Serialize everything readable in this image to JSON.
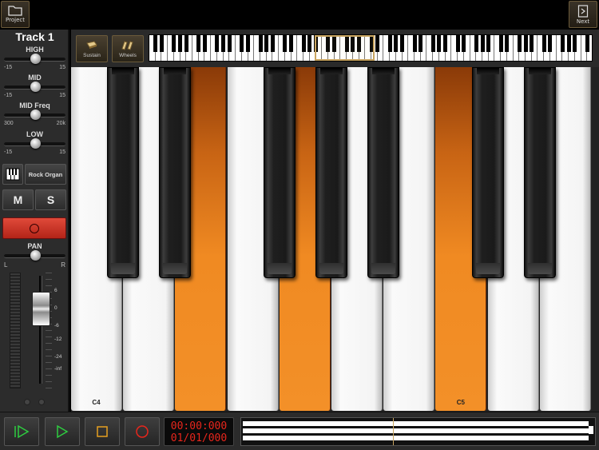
{
  "topbar": {
    "project_label": "Project",
    "next_label": "Next",
    "project_icon": "folder-icon",
    "next_icon": "page-arrow-icon"
  },
  "track": {
    "title": "Track 1",
    "eq": [
      {
        "label": "HIGH",
        "min": "-15",
        "max": "15",
        "value": 0.5
      },
      {
        "label": "MID",
        "min": "-15",
        "max": "15",
        "value": 0.5
      },
      {
        "label": "MID Freq",
        "min": "300",
        "max": "20k",
        "value": 0.5
      },
      {
        "label": "LOW",
        "min": "-15",
        "max": "15",
        "value": 0.5
      }
    ],
    "instrument": {
      "icon": "keyboard-icon",
      "name": "Rock Organ"
    },
    "mute_label": "M",
    "solo_label": "S",
    "record_arm_color": "#d63a2a",
    "pan": {
      "label": "PAN",
      "left": "L",
      "right": "R",
      "value": 0.5
    },
    "fader": {
      "scale": [
        "6",
        "0",
        "-6",
        "-12",
        "-24",
        "-inf"
      ],
      "value_db": "0"
    }
  },
  "keyboard_header": {
    "sustain_label": "Sustain",
    "wheels_label": "Wheels",
    "accent_color": "#c9a560"
  },
  "keyboard": {
    "white_keys": [
      {
        "note": "C4",
        "pressed": false
      },
      {
        "note": "",
        "pressed": false
      },
      {
        "note": "",
        "pressed": true
      },
      {
        "note": "",
        "pressed": false
      },
      {
        "note": "",
        "pressed": true
      },
      {
        "note": "",
        "pressed": false
      },
      {
        "note": "",
        "pressed": false
      },
      {
        "note": "C5",
        "pressed": true
      },
      {
        "note": "",
        "pressed": false
      },
      {
        "note": "",
        "pressed": false
      }
    ],
    "pressed_color": "#f08a22"
  },
  "transport": {
    "return_icon": "return-to-start-icon",
    "play_icon": "play-icon",
    "stop_icon": "stop-icon",
    "record_icon": "record-icon",
    "time": "00:00:000",
    "position": "01/01/000",
    "time_color": "#e8261c"
  }
}
